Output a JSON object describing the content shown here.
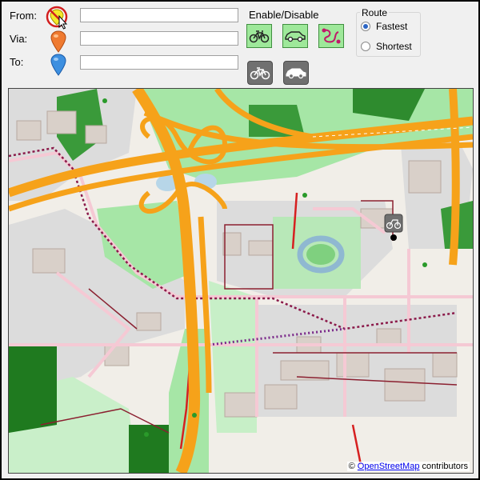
{
  "form": {
    "from_label": "From:",
    "via_label": "Via:",
    "to_label": "To:",
    "from_value": "",
    "via_value": "",
    "to_value": ""
  },
  "toggles": {
    "heading": "Enable/Disable",
    "buttons": [
      {
        "name": "bicycle",
        "state": "on"
      },
      {
        "name": "car",
        "state": "on"
      },
      {
        "name": "route",
        "state": "on"
      },
      {
        "name": "bicycle",
        "state": "off"
      },
      {
        "name": "car",
        "state": "off"
      }
    ]
  },
  "route": {
    "title": "Route",
    "options": [
      {
        "label": "Fastest",
        "selected": true
      },
      {
        "label": "Shortest",
        "selected": false
      }
    ]
  },
  "map": {
    "attribution_prefix": "©",
    "attribution_link": "OpenStreetMap",
    "attribution_suffix": "contributors"
  },
  "colors": {
    "motorway": "#f6a21a",
    "grass": "#a6e6a6",
    "forest": "#1f7a1f",
    "water": "#b7d6e8",
    "residential": "#e0dfdf",
    "building": "#d9d0c9",
    "cycleway_route": "#8b1a4a",
    "pink_road": "#f5c9d4",
    "toggle_on": "#9ee89a",
    "toggle_dark": "#707070"
  }
}
